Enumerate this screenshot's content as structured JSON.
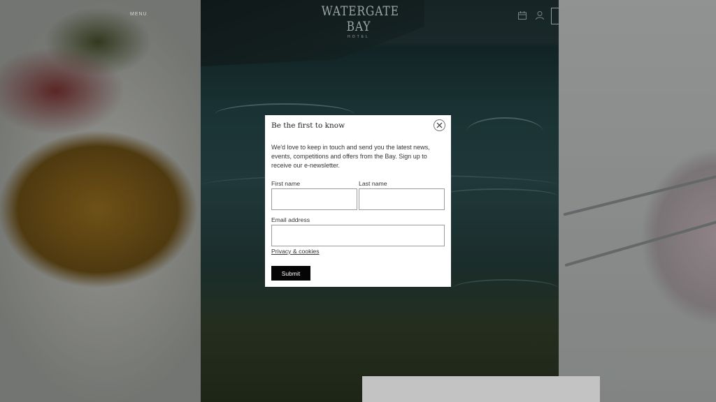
{
  "header": {
    "menu_label": "MENU",
    "logo_title": "WATERGATE BAY",
    "logo_subtitle": "HOTEL"
  },
  "icons": {
    "calendar": "calendar-icon",
    "account": "user-icon",
    "close": "close-icon"
  },
  "modal": {
    "title": "Be the first to know",
    "intro": "We'd love to keep in touch and send you the latest news, events, competitions and offers from the Bay. Sign up to receive our e-newsletter.",
    "first_name_label": "First name",
    "first_name_value": "",
    "last_name_label": "Last name",
    "last_name_value": "",
    "email_label": "Email address",
    "email_value": "",
    "privacy_link": "Privacy & cookies",
    "submit_label": "Submit"
  },
  "colors": {
    "overlay": "#000000",
    "submit_bg": "#050505",
    "modal_bg": "#ffffff"
  }
}
